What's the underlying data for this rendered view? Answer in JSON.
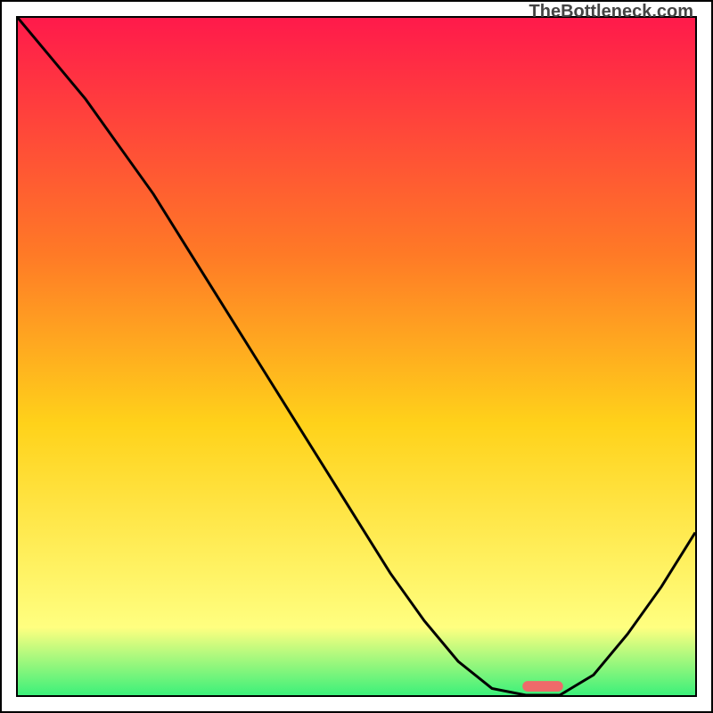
{
  "chart_data": {
    "type": "line",
    "x": [
      0.0,
      0.05,
      0.1,
      0.15,
      0.2,
      0.25,
      0.3,
      0.35,
      0.4,
      0.45,
      0.5,
      0.55,
      0.6,
      0.65,
      0.7,
      0.75,
      0.8,
      0.85,
      0.9,
      0.95,
      1.0
    ],
    "values": [
      1.0,
      0.94,
      0.88,
      0.81,
      0.74,
      0.66,
      0.58,
      0.5,
      0.42,
      0.34,
      0.26,
      0.18,
      0.11,
      0.05,
      0.01,
      0.0,
      0.0,
      0.03,
      0.09,
      0.16,
      0.24
    ],
    "optimum_x": 0.775,
    "optimum_width": 0.06,
    "title": "",
    "xlabel": "",
    "ylabel": "",
    "xlim": [
      0,
      1
    ],
    "ylim": [
      0,
      1
    ],
    "annotations": [],
    "watermark": "TheBottleneck.com",
    "gradient_colors": {
      "top": "#ff1a4b",
      "upper": "#ff7a26",
      "mid": "#ffd21a",
      "lower": "#ffff80",
      "base": "#3cf07a"
    },
    "marker_color": "#ef6a6a"
  }
}
